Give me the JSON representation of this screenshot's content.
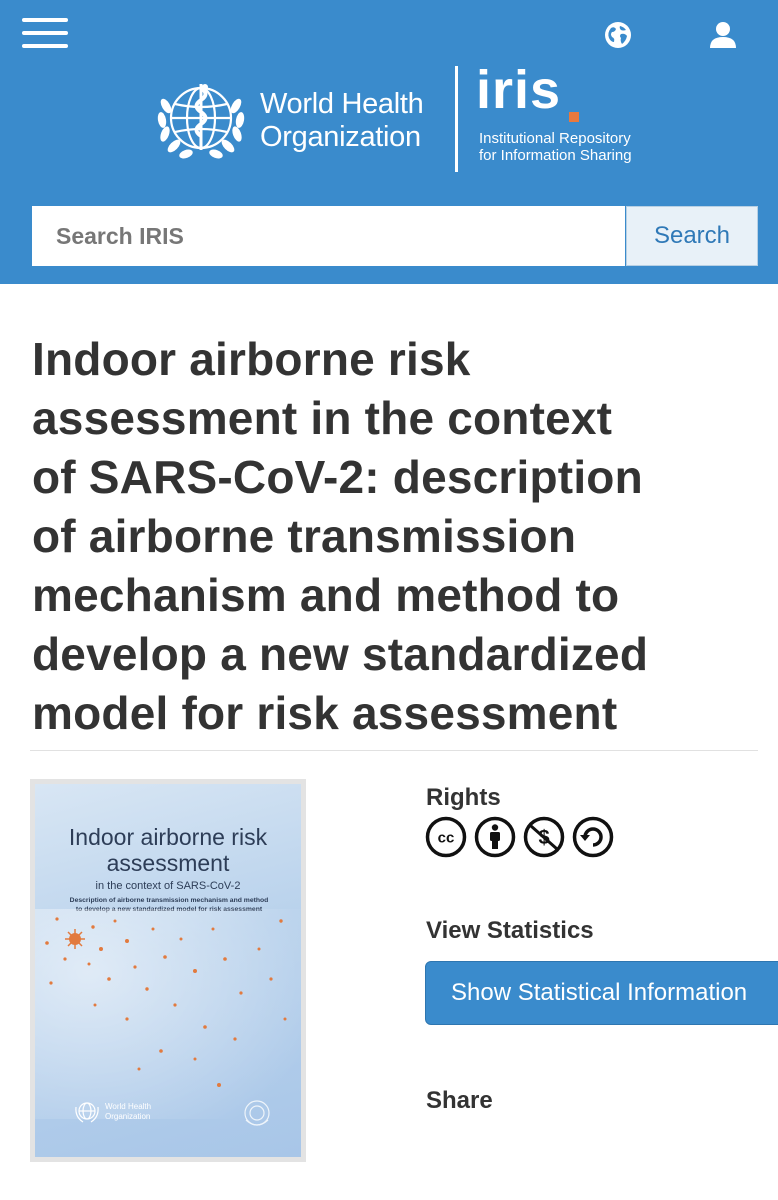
{
  "header": {
    "brand": {
      "who_line1": "World Health",
      "who_line2": "Organization"
    },
    "iris": {
      "word": "iris",
      "subtitle_line1": "Institutional Repository",
      "subtitle_line2": "for Information Sharing"
    },
    "search": {
      "placeholder": "Search IRIS",
      "value": "",
      "button_label": "Search"
    }
  },
  "item": {
    "title_lines": [
      "Indoor airborne risk",
      "assessment in the context",
      "of SARS-CoV-2: description",
      "of airborne transmission",
      "mechanism and method to",
      "develop a new standardized",
      "model for risk assessment"
    ],
    "cover": {
      "title_line1": "Indoor airborne risk",
      "title_line2": "assessment",
      "subtitle": "in the context of SARS-CoV-2",
      "description_line1": "Description of airborne transmission mechanism and method",
      "description_line2": "to develop a new standardized model for risk assessment",
      "publisher_line1": "World Health",
      "publisher_line2": "Organization"
    },
    "rights": {
      "label": "Rights",
      "licence_icons": [
        "cc-icon",
        "attribution-icon",
        "noncommercial-icon",
        "sharealike-icon"
      ]
    },
    "statistics": {
      "label": "View Statistics",
      "button_label": "Show Statistical Information"
    },
    "share": {
      "label": "Share"
    }
  },
  "colors": {
    "header_bg": "#3a8bcc",
    "accent_orange": "#e8793d",
    "text": "#333333"
  },
  "icons": {
    "menu": "hamburger-icon",
    "language": "globe-icon",
    "account": "user-icon"
  }
}
